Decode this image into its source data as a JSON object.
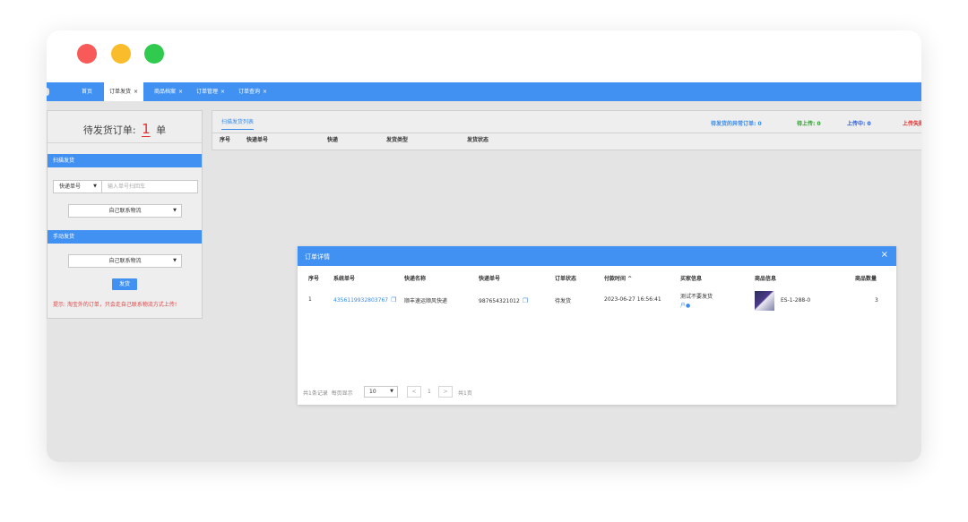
{
  "tabs": [
    {
      "label": "首页",
      "closable": false
    },
    {
      "label": "订单发货",
      "closable": true,
      "active": true
    },
    {
      "label": "商品档案",
      "closable": true
    },
    {
      "label": "订单管理",
      "closable": true
    },
    {
      "label": "订单查询",
      "closable": true
    }
  ],
  "close_symbol": "×",
  "left_panel": {
    "pending_label": "待发货订单:",
    "pending_count": "1",
    "pending_unit": "单",
    "scan_section": "扫描发货",
    "scan_type": "快递单号",
    "scan_placeholder": "输入单号扫回车",
    "logistics_option_1": "自己联系物流",
    "manual_section": "手动发货",
    "logistics_option_2": "自己联系物流",
    "send_button": "发货",
    "hint": "提示: 淘宝外的订单，只会走自己联系物流方式上传!"
  },
  "list_panel": {
    "tab": "扫描发货列表",
    "stats": [
      {
        "label": "待发货的异常订单: 0",
        "color": "#3a8ae8"
      },
      {
        "label": "待上传: 0",
        "color": "#2e9b2e"
      },
      {
        "label": "上传中: 0",
        "color": "#2a5bd7"
      },
      {
        "label": "上传失败",
        "color": "#e23030"
      }
    ],
    "columns": [
      "序号",
      "快递单号",
      "快递",
      "发货类型",
      "发货状态"
    ]
  },
  "modal": {
    "title": "订单详情",
    "close": "×",
    "columns": [
      "序号",
      "系统单号",
      "快递名称",
      "快递单号",
      "订单状态",
      "付款时间 ^",
      "买家信息",
      "商品信息",
      "商品数量"
    ],
    "row": {
      "index": "1",
      "system_no": "4356119932803767",
      "courier": "顺丰速运顺风快递",
      "tracking_no": "987654321012",
      "status": "待发货",
      "pay_time": "2023-06-27 16:56:41",
      "buyer_line1": "测试不要发货",
      "buyer_line2": "户",
      "product": "ES-1-288-0",
      "quantity": "3"
    },
    "pager": {
      "total": "共1条记录",
      "per_page_label": "每页显示",
      "per_page": "10",
      "prev": "<",
      "page": "1",
      "next": ">",
      "pages": "共1页"
    }
  },
  "colors": {
    "accent": "#4191f2",
    "warning": "#e23030"
  },
  "icons": {
    "copy": "copy-icon",
    "chevron": "chevron-down-icon",
    "avatar": "user-icon"
  }
}
